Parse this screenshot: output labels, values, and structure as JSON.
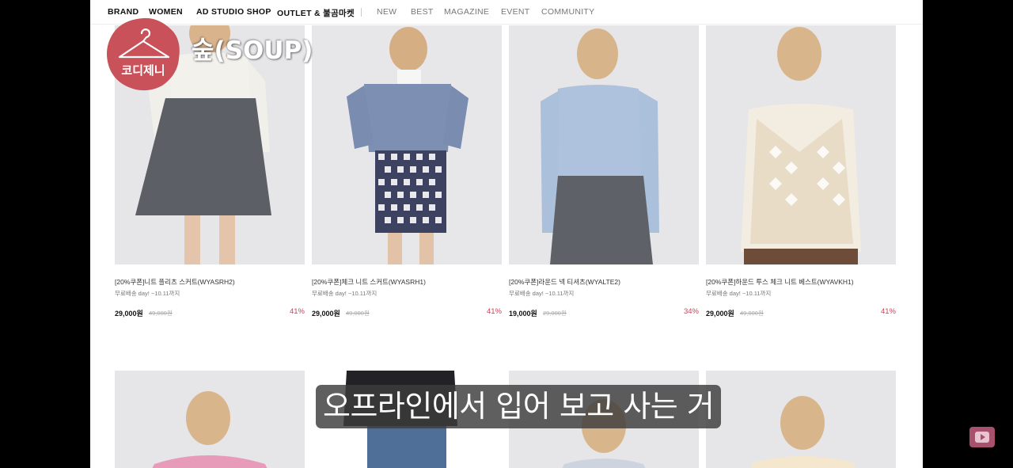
{
  "nav": {
    "primary": [
      "BRAND",
      "WOMEN",
      "AD STUDIO SHOP",
      "OUTLET & 불곰마켓"
    ],
    "secondary": [
      "NEW",
      "BEST",
      "MAGAZINE",
      "EVENT",
      "COMMUNITY"
    ]
  },
  "overlay": {
    "badge_text": "코디제니",
    "channel_title": "숲(SOUP)",
    "subtitle": "오프라인에서 입어 보고 사는 거"
  },
  "products": [
    {
      "name": "[20%쿠폰]니트 플리츠 스커트(WYASRH2)",
      "note": "무료배송 day! ~10.11까지",
      "price": "29,000원",
      "original": "49,000원",
      "discount": "41%"
    },
    {
      "name": "[20%쿠폰]체크 니트 스커트(WYASRH1)",
      "note": "무료배송 day! ~10.11까지",
      "price": "29,000원",
      "original": "49,000원",
      "discount": "41%"
    },
    {
      "name": "[20%쿠폰]라운드 넥 티셔츠(WYALTE2)",
      "note": "무료배송 day! ~10.11까지",
      "price": "19,000원",
      "original": "29,000원",
      "discount": "34%"
    },
    {
      "name": "[20%쿠폰]하운드 투스 체크 니트 베스트(WYAVKH1)",
      "note": "무료배송 day! ~10.11까지",
      "price": "29,000원",
      "original": "49,000원",
      "discount": "41%"
    }
  ],
  "colors": {
    "accent": "#c2465a",
    "badge": "#c9525a"
  },
  "icons": [
    "hanger-icon",
    "play-icon"
  ]
}
